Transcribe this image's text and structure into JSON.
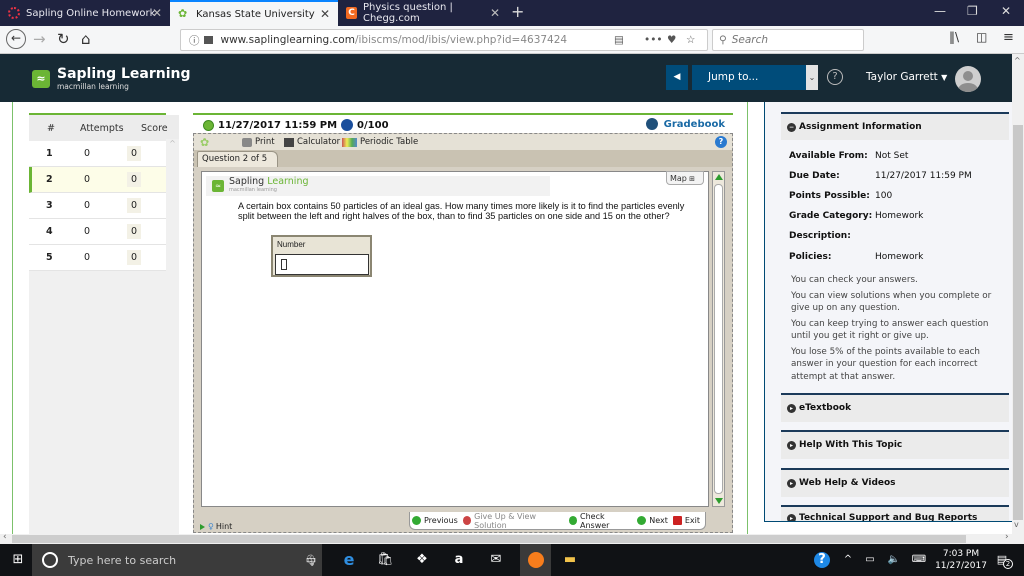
{
  "browser": {
    "tabs": [
      {
        "label": "Sapling Online Homework",
        "active": false
      },
      {
        "label": "Kansas State University - PHYS",
        "active": true
      },
      {
        "label": "Physics question | Chegg.com",
        "active": false
      }
    ],
    "url_domain": "www.saplinglearning.com",
    "url_path": "/ibiscms/mod/ibis/view.php?id=4637424",
    "search_placeholder": "Search"
  },
  "header": {
    "brand": "Sapling Learning",
    "brand_sub": "macmillan learning",
    "jump_to": "Jump to...",
    "user_name": "Taylor Garrett"
  },
  "question_list": {
    "columns": [
      "#",
      "Attempts",
      "Score"
    ],
    "rows": [
      {
        "num": "1",
        "attempts": "0",
        "score": "0"
      },
      {
        "num": "2",
        "attempts": "0",
        "score": "0",
        "selected": true
      },
      {
        "num": "3",
        "attempts": "0",
        "score": "0"
      },
      {
        "num": "4",
        "attempts": "0",
        "score": "0"
      },
      {
        "num": "5",
        "attempts": "0",
        "score": "0"
      }
    ]
  },
  "question": {
    "due": "11/27/2017 11:59 PM",
    "score": "0/100",
    "gradebook": "Gradebook",
    "toolbar": {
      "print": "Print",
      "calculator": "Calculator",
      "periodic_table": "Periodic Table"
    },
    "tab_label": "Question 2 of 5",
    "map_label": "Map",
    "inner_brand_a": "Sapling",
    "inner_brand_b": "Learning",
    "inner_brand_sub": "macmillan learning",
    "text": "A certain box contains 50 particles of an ideal gas. How many times more likely is it to find the particles evenly split between the left and right halves of the box, than to find 35 particles on one side and 15 on the other?",
    "answer_label": "Number",
    "answer_value": "",
    "hint": "Hint",
    "nav": {
      "previous": "Previous",
      "give_up": "Give Up & View Solution",
      "check": "Check Answer",
      "next": "Next",
      "exit": "Exit"
    }
  },
  "assignment_info": {
    "title": "Assignment Information",
    "fields": [
      {
        "key": "Available From:",
        "value": "Not Set"
      },
      {
        "key": "Due Date:",
        "value": "11/27/2017 11:59 PM"
      },
      {
        "key": "Points Possible:",
        "value": "100"
      },
      {
        "key": "Grade Category:",
        "value": "Homework"
      },
      {
        "key": "Description:",
        "value": ""
      },
      {
        "key": "Policies:",
        "value": "Homework"
      }
    ],
    "policies": [
      "You can check your answers.",
      "You can view solutions when you complete or give up on any question.",
      "You can keep trying to answer each question until you get it right or give up.",
      "You lose 5% of the points available to each answer in your question for each incorrect attempt at that answer."
    ],
    "sections": [
      "eTextbook",
      "Help With This Topic",
      "Web Help & Videos",
      "Technical Support and Bug Reports"
    ]
  },
  "taskbar": {
    "search_placeholder": "Type here to search",
    "time": "7:03 PM",
    "date": "11/27/2017",
    "notifications": "2"
  }
}
